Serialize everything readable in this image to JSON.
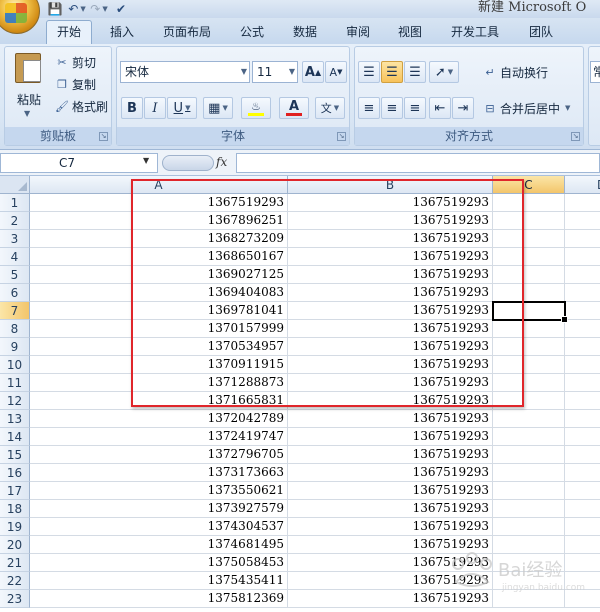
{
  "app": {
    "window_title": "新建 Microsoft O",
    "quick_access": [
      "save-icon",
      "undo-icon",
      "redo-icon",
      "customize-icon"
    ]
  },
  "ribbon": {
    "tabs": [
      "开始",
      "插入",
      "页面布局",
      "公式",
      "数据",
      "审阅",
      "视图",
      "开发工具",
      "团队"
    ],
    "active_tab": "开始",
    "clipboard": {
      "group_label": "剪贴板",
      "paste": "粘贴",
      "cut": "剪切",
      "copy": "复制",
      "format_painter": "格式刷"
    },
    "font": {
      "group_label": "字体",
      "font_name": "宋体",
      "font_size": "11",
      "bold": "B",
      "italic": "I",
      "underline": "U",
      "grow": "A",
      "shrink": "A",
      "font_color_glyph": "A",
      "phonetic_glyph": "文",
      "font_color": "#e02020",
      "fill_color": "#ffff00"
    },
    "alignment": {
      "group_label": "对齐方式",
      "wrap_text": "自动换行",
      "merge_center": "合并后居中"
    },
    "number": {
      "format_preview": "常"
    }
  },
  "formula_bar": {
    "name_box": "C7",
    "fx_label": "fx",
    "formula": ""
  },
  "sheet": {
    "columns": [
      "A",
      "B",
      "C",
      "D"
    ],
    "selected_column": "C",
    "selected_row": 7,
    "active_cell": "C7",
    "rows": [
      {
        "num": "1",
        "a": "1367519293",
        "b": "1367519293"
      },
      {
        "num": "2",
        "a": "1367896251",
        "b": "1367519293"
      },
      {
        "num": "3",
        "a": "1368273209",
        "b": "1367519293"
      },
      {
        "num": "4",
        "a": "1368650167",
        "b": "1367519293"
      },
      {
        "num": "5",
        "a": "1369027125",
        "b": "1367519293"
      },
      {
        "num": "6",
        "a": "1369404083",
        "b": "1367519293"
      },
      {
        "num": "7",
        "a": "1369781041",
        "b": "1367519293"
      },
      {
        "num": "8",
        "a": "1370157999",
        "b": "1367519293"
      },
      {
        "num": "9",
        "a": "1370534957",
        "b": "1367519293"
      },
      {
        "num": "10",
        "a": "1370911915",
        "b": "1367519293"
      },
      {
        "num": "11",
        "a": "1371288873",
        "b": "1367519293"
      },
      {
        "num": "12",
        "a": "1371665831",
        "b": "1367519293"
      },
      {
        "num": "13",
        "a": "1372042789",
        "b": "1367519293"
      },
      {
        "num": "14",
        "a": "1372419747",
        "b": "1367519293"
      },
      {
        "num": "15",
        "a": "1372796705",
        "b": "1367519293"
      },
      {
        "num": "16",
        "a": "1373173663",
        "b": "1367519293"
      },
      {
        "num": "17",
        "a": "1373550621",
        "b": "1367519293"
      },
      {
        "num": "18",
        "a": "1373927579",
        "b": "1367519293"
      },
      {
        "num": "19",
        "a": "1374304537",
        "b": "1367519293"
      },
      {
        "num": "20",
        "a": "1374681495",
        "b": "1367519293"
      },
      {
        "num": "21",
        "a": "1375058453",
        "b": "1367519293"
      },
      {
        "num": "22",
        "a": "1375435411",
        "b": "1367519293"
      },
      {
        "num": "23",
        "a": "1375812369",
        "b": "1367519293"
      }
    ]
  },
  "annotation": {
    "highlight_color": "#e0262b"
  },
  "watermark": {
    "text": "Bai经验",
    "subtext": "jingyan.baidu.com"
  }
}
